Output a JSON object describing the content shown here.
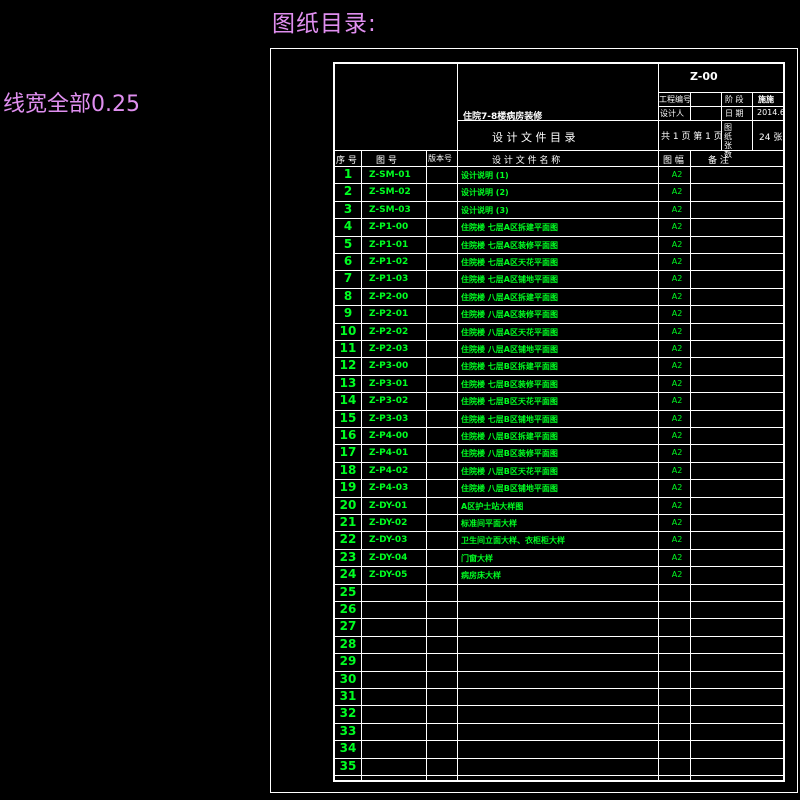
{
  "heading": "图纸目录:",
  "note": "线宽全部0.25",
  "title_block": {
    "drawing_no": "Z-00",
    "project_name": "住院7-8楼病房装修",
    "doc_title": "设  计  文  件  目  录",
    "project_code_label": "工程编号",
    "stage_label": "阶 段",
    "stage_value": "施施",
    "designer_label": "设计人",
    "date_label": "日 期",
    "date_value": "2014.6",
    "pages": "共 1 页 第 1 页",
    "sheet_count_label": "图 纸 张 数",
    "sheet_count_value": "24 张"
  },
  "columns": [
    "序 号",
    "图   号",
    "版本号",
    "设   计   文   件   名   称",
    "图 幅",
    "备     注"
  ],
  "rows": [
    {
      "no": "1",
      "code": "Z-SM-01",
      "name": "设计说明 (1)",
      "size": "A2"
    },
    {
      "no": "2",
      "code": "Z-SM-02",
      "name": "设计说明 (2)",
      "size": "A2"
    },
    {
      "no": "3",
      "code": "Z-SM-03",
      "name": "设计说明 (3)",
      "size": "A2"
    },
    {
      "no": "4",
      "code": "Z-P1-00",
      "name": "住院楼 七层A区拆建平面图",
      "size": "A2"
    },
    {
      "no": "5",
      "code": "Z-P1-01",
      "name": "住院楼 七层A区装修平面图",
      "size": "A2"
    },
    {
      "no": "6",
      "code": "Z-P1-02",
      "name": "住院楼 七层A区天花平面图",
      "size": "A2"
    },
    {
      "no": "7",
      "code": "Z-P1-03",
      "name": "住院楼 七层A区铺地平面图",
      "size": "A2"
    },
    {
      "no": "8",
      "code": "Z-P2-00",
      "name": "住院楼 八层A区拆建平面图",
      "size": "A2"
    },
    {
      "no": "9",
      "code": "Z-P2-01",
      "name": "住院楼 八层A区装修平面图",
      "size": "A2"
    },
    {
      "no": "10",
      "code": "Z-P2-02",
      "name": "住院楼 八层A区天花平面图",
      "size": "A2"
    },
    {
      "no": "11",
      "code": "Z-P2-03",
      "name": "住院楼 八层A区铺地平面图",
      "size": "A2"
    },
    {
      "no": "12",
      "code": "Z-P3-00",
      "name": "住院楼 七层B区拆建平面图",
      "size": "A2"
    },
    {
      "no": "13",
      "code": "Z-P3-01",
      "name": "住院楼 七层B区装修平面图",
      "size": "A2"
    },
    {
      "no": "14",
      "code": "Z-P3-02",
      "name": "住院楼 七层B区天花平面图",
      "size": "A2"
    },
    {
      "no": "15",
      "code": "Z-P3-03",
      "name": "住院楼 七层B区铺地平面图",
      "size": "A2"
    },
    {
      "no": "16",
      "code": "Z-P4-00",
      "name": "住院楼 八层B区拆建平面图",
      "size": "A2"
    },
    {
      "no": "17",
      "code": "Z-P4-01",
      "name": "住院楼 八层B区装修平面图",
      "size": "A2"
    },
    {
      "no": "18",
      "code": "Z-P4-02",
      "name": "住院楼 八层B区天花平面图",
      "size": "A2"
    },
    {
      "no": "19",
      "code": "Z-P4-03",
      "name": "住院楼 八层B区铺地平面图",
      "size": "A2"
    },
    {
      "no": "20",
      "code": "Z-DY-01",
      "name": "A区护士站大样图",
      "size": "A2"
    },
    {
      "no": "21",
      "code": "Z-DY-02",
      "name": "标准间平面大样",
      "size": "A2"
    },
    {
      "no": "22",
      "code": "Z-DY-03",
      "name": "卫生间立面大样、衣柜柜大样",
      "size": "A2"
    },
    {
      "no": "23",
      "code": "Z-DY-04",
      "name": "门窗大样",
      "size": "A2"
    },
    {
      "no": "24",
      "code": "Z-DY-05",
      "name": "病房床大样",
      "size": "A2"
    },
    {
      "no": "25",
      "code": "",
      "name": "",
      "size": ""
    },
    {
      "no": "26",
      "code": "",
      "name": "",
      "size": ""
    },
    {
      "no": "27",
      "code": "",
      "name": "",
      "size": ""
    },
    {
      "no": "28",
      "code": "",
      "name": "",
      "size": ""
    },
    {
      "no": "29",
      "code": "",
      "name": "",
      "size": ""
    },
    {
      "no": "30",
      "code": "",
      "name": "",
      "size": ""
    },
    {
      "no": "31",
      "code": "",
      "name": "",
      "size": ""
    },
    {
      "no": "32",
      "code": "",
      "name": "",
      "size": ""
    },
    {
      "no": "33",
      "code": "",
      "name": "",
      "size": ""
    },
    {
      "no": "34",
      "code": "",
      "name": "",
      "size": ""
    },
    {
      "no": "35",
      "code": "",
      "name": "",
      "size": ""
    }
  ]
}
